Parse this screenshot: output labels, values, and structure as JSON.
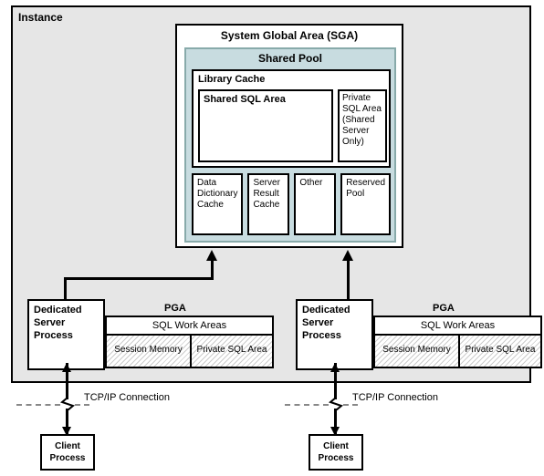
{
  "instance": {
    "label": "Instance"
  },
  "sga": {
    "title": "System Global Area (SGA)",
    "shared_pool": {
      "title": "Shared Pool",
      "library_cache": {
        "title": "Library Cache",
        "shared_sql_area": "Shared SQL Area",
        "private_sql_area": "Private SQL Area (Shared Server Only)"
      },
      "boxes": {
        "data_dictionary_cache": "Data Dictionary Cache",
        "server_result_cache": "Server Result Cache",
        "other": "Other",
        "reserved_pool": "Reserved Pool"
      }
    }
  },
  "process": {
    "dedicated_server": "Dedicated Server Process",
    "pga_label": "PGA",
    "sql_work_areas": "SQL Work Areas",
    "session_memory": "Session Memory",
    "private_sql_area": "Private SQL Area"
  },
  "connection": {
    "tcpip": "TCP/IP Connection",
    "client_process": "Client Process"
  }
}
